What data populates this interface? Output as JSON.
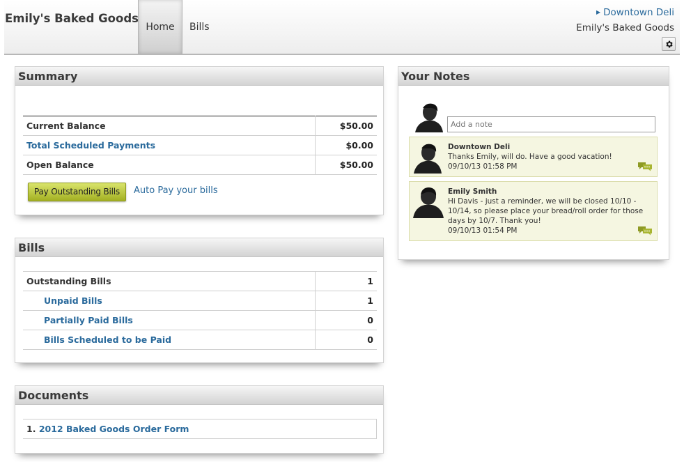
{
  "header": {
    "brand": "Emily's Baked Goods",
    "nav": [
      {
        "label": "Home",
        "active": true
      },
      {
        "label": "Bills",
        "active": false
      }
    ],
    "account_link": "Downtown Deli",
    "account_name": "Emily's Baked Goods"
  },
  "summary": {
    "title": "Summary",
    "rows": [
      {
        "label": "Current Balance",
        "value": "$50.00"
      },
      {
        "label": "Total Scheduled Payments",
        "value": "$0.00"
      },
      {
        "label": "Open Balance",
        "value": "$50.00"
      }
    ],
    "pay_button": "Pay Outstanding Bills",
    "autopay_link": "Auto Pay your bills"
  },
  "bills": {
    "title": "Bills",
    "rows": [
      {
        "label": "Outstanding Bills",
        "value": "1"
      },
      {
        "label": "Unpaid Bills",
        "value": "1"
      },
      {
        "label": "Partially Paid Bills",
        "value": "0"
      },
      {
        "label": "Bills Scheduled to be Paid",
        "value": "0"
      }
    ]
  },
  "documents": {
    "title": "Documents",
    "items": [
      {
        "number": "1.",
        "label": "2012 Baked Goods Order Form"
      }
    ]
  },
  "notes": {
    "title": "Your Notes",
    "placeholder": "Add a note",
    "items": [
      {
        "author": "Downtown Deli",
        "text": "Thanks Emily, will do. Have a good vacation!",
        "timestamp": "09/10/13 01:58 PM"
      },
      {
        "author": "Emily Smith",
        "text": "Hi Davis - just a reminder, we will be closed 10/10 - 10/14, so please place your bread/roll order for those days by 10/7. Thank you!",
        "timestamp": "09/10/13 01:54 PM"
      }
    ]
  },
  "colors": {
    "link": "#2a6a9c",
    "note_bg": "#f5f6e1",
    "button": "#b9c43a"
  },
  "icons": [
    "settings-gear-icon",
    "user-avatar-icon",
    "chat-bubbles-icon",
    "caret-right-icon"
  ]
}
